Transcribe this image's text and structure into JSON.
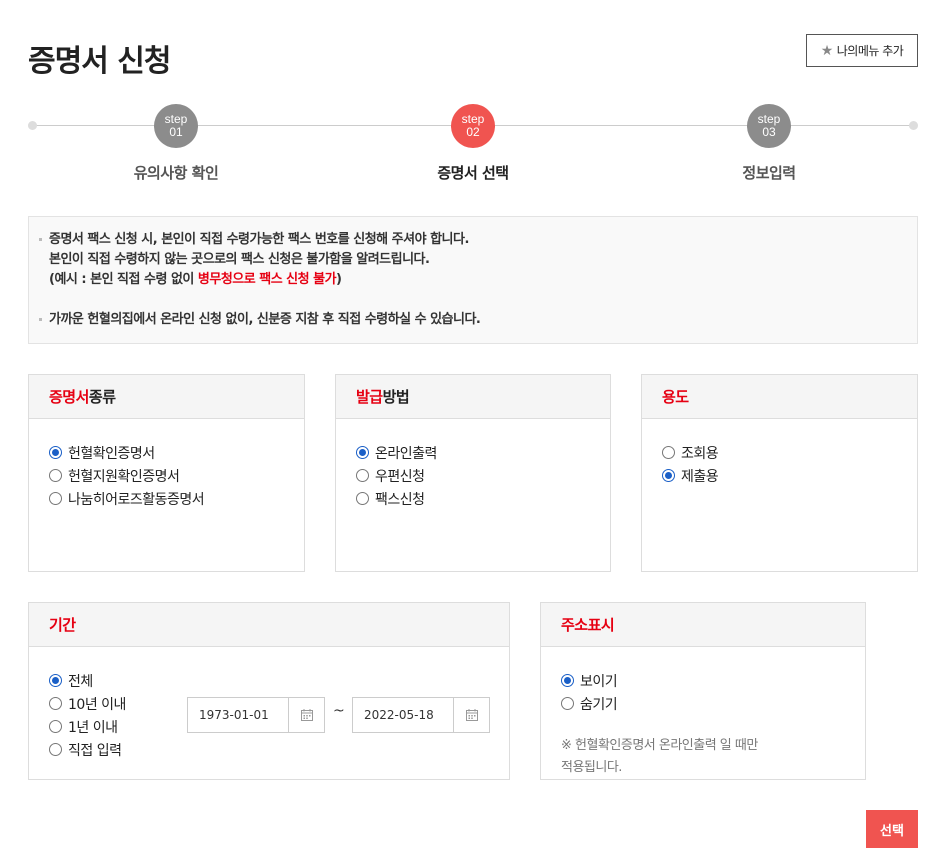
{
  "page_title": "증명서 신청",
  "mymenu": {
    "icon": "star-icon",
    "label": "나의메뉴 추가"
  },
  "steps": [
    {
      "num_top": "step",
      "num_bottom": "01",
      "label": "유의사항 확인",
      "active": false
    },
    {
      "num_top": "step",
      "num_bottom": "02",
      "label": "증명서 선택",
      "active": true
    },
    {
      "num_top": "step",
      "num_bottom": "03",
      "label": "정보입력",
      "active": false
    }
  ],
  "notice": {
    "line1": "증명서 팩스 신청 시, 본인이 직접 수령가능한 팩스 번호를 신청해 주셔야 합니다.",
    "line2": "본인이 직접 수령하지 않는 곳으로의 팩스 신청은 불가함을 알려드립니다.",
    "line3_prefix": "(예시 : 본인 직접 수령 없이 ",
    "line3_red": "병무청으로 팩스 신청 불가",
    "line3_suffix": ")",
    "line4": "가까운 헌혈의집에서 온라인 신청 없이, 신분증 지참 후 직접 수령하실 수 있습니다."
  },
  "cert_type": {
    "title_red": "증명서",
    "title_rest": "종류",
    "options": [
      "헌혈확인증명서",
      "헌혈지원확인증명서",
      "나눔히어로즈활동증명서"
    ],
    "selected": 0
  },
  "issue_method": {
    "title_red": "발급",
    "title_rest": "방법",
    "options": [
      "온라인출력",
      "우편신청",
      "팩스신청"
    ],
    "selected": 0
  },
  "purpose": {
    "title_red": "용도",
    "options": [
      "조회용",
      "제출용"
    ],
    "selected": 1
  },
  "period": {
    "title_red": "기간",
    "options": [
      "전체",
      "10년 이내",
      "1년 이내",
      "직접 입력"
    ],
    "selected": 0,
    "start_date": "1973-01-01",
    "end_date": "2022-05-18",
    "separator": "~"
  },
  "address": {
    "title_red": "주소표시",
    "options": [
      "보이기",
      "숨기기"
    ],
    "selected": 0,
    "note_line1": "※ 헌혈확인증명서 온라인출력 일 때만",
    "note_line2": "적용됩니다."
  },
  "select_button": "선택",
  "colors": {
    "accent_red": "#f05450",
    "text_red": "#e60012",
    "radio_blue": "#1a5fc7",
    "step_gray": "#8c8c8c"
  }
}
